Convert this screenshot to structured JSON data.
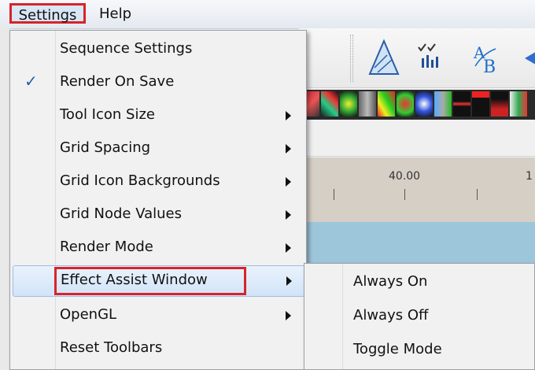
{
  "menubar": {
    "settings_label": "Settings",
    "help_label": "Help"
  },
  "timeline": {
    "label_40": "40.00",
    "label_partial": "1"
  },
  "settings_menu": {
    "items": [
      {
        "label": "Sequence Settings",
        "checked": false,
        "has_submenu": false
      },
      {
        "label": "Render On Save",
        "checked": true,
        "has_submenu": false
      },
      {
        "label": "Tool Icon Size",
        "checked": false,
        "has_submenu": true
      },
      {
        "label": "Grid Spacing",
        "checked": false,
        "has_submenu": true
      },
      {
        "label": "Grid Icon Backgrounds",
        "checked": false,
        "has_submenu": true
      },
      {
        "label": "Grid Node Values",
        "checked": false,
        "has_submenu": true
      },
      {
        "label": "Render Mode",
        "checked": false,
        "has_submenu": true
      },
      {
        "label": "Effect Assist Window",
        "checked": false,
        "has_submenu": true,
        "highlighted": true
      },
      {
        "label": "OpenGL",
        "checked": false,
        "has_submenu": true
      },
      {
        "label": "Reset Toolbars",
        "checked": false,
        "has_submenu": false
      }
    ],
    "check_glyph": "✓"
  },
  "effect_assist_submenu": {
    "items": [
      {
        "label": "Always On"
      },
      {
        "label": "Always Off"
      },
      {
        "label": "Toggle Mode"
      }
    ]
  },
  "colors": {
    "annotation_red": "#d8232a",
    "highlight": "#d2e4f8",
    "checkmark": "#1f5fb8"
  },
  "icons": [
    "triangle-tool-icon",
    "bars-tool-icon",
    "text-tool-icon",
    "effects-palette-icons"
  ]
}
